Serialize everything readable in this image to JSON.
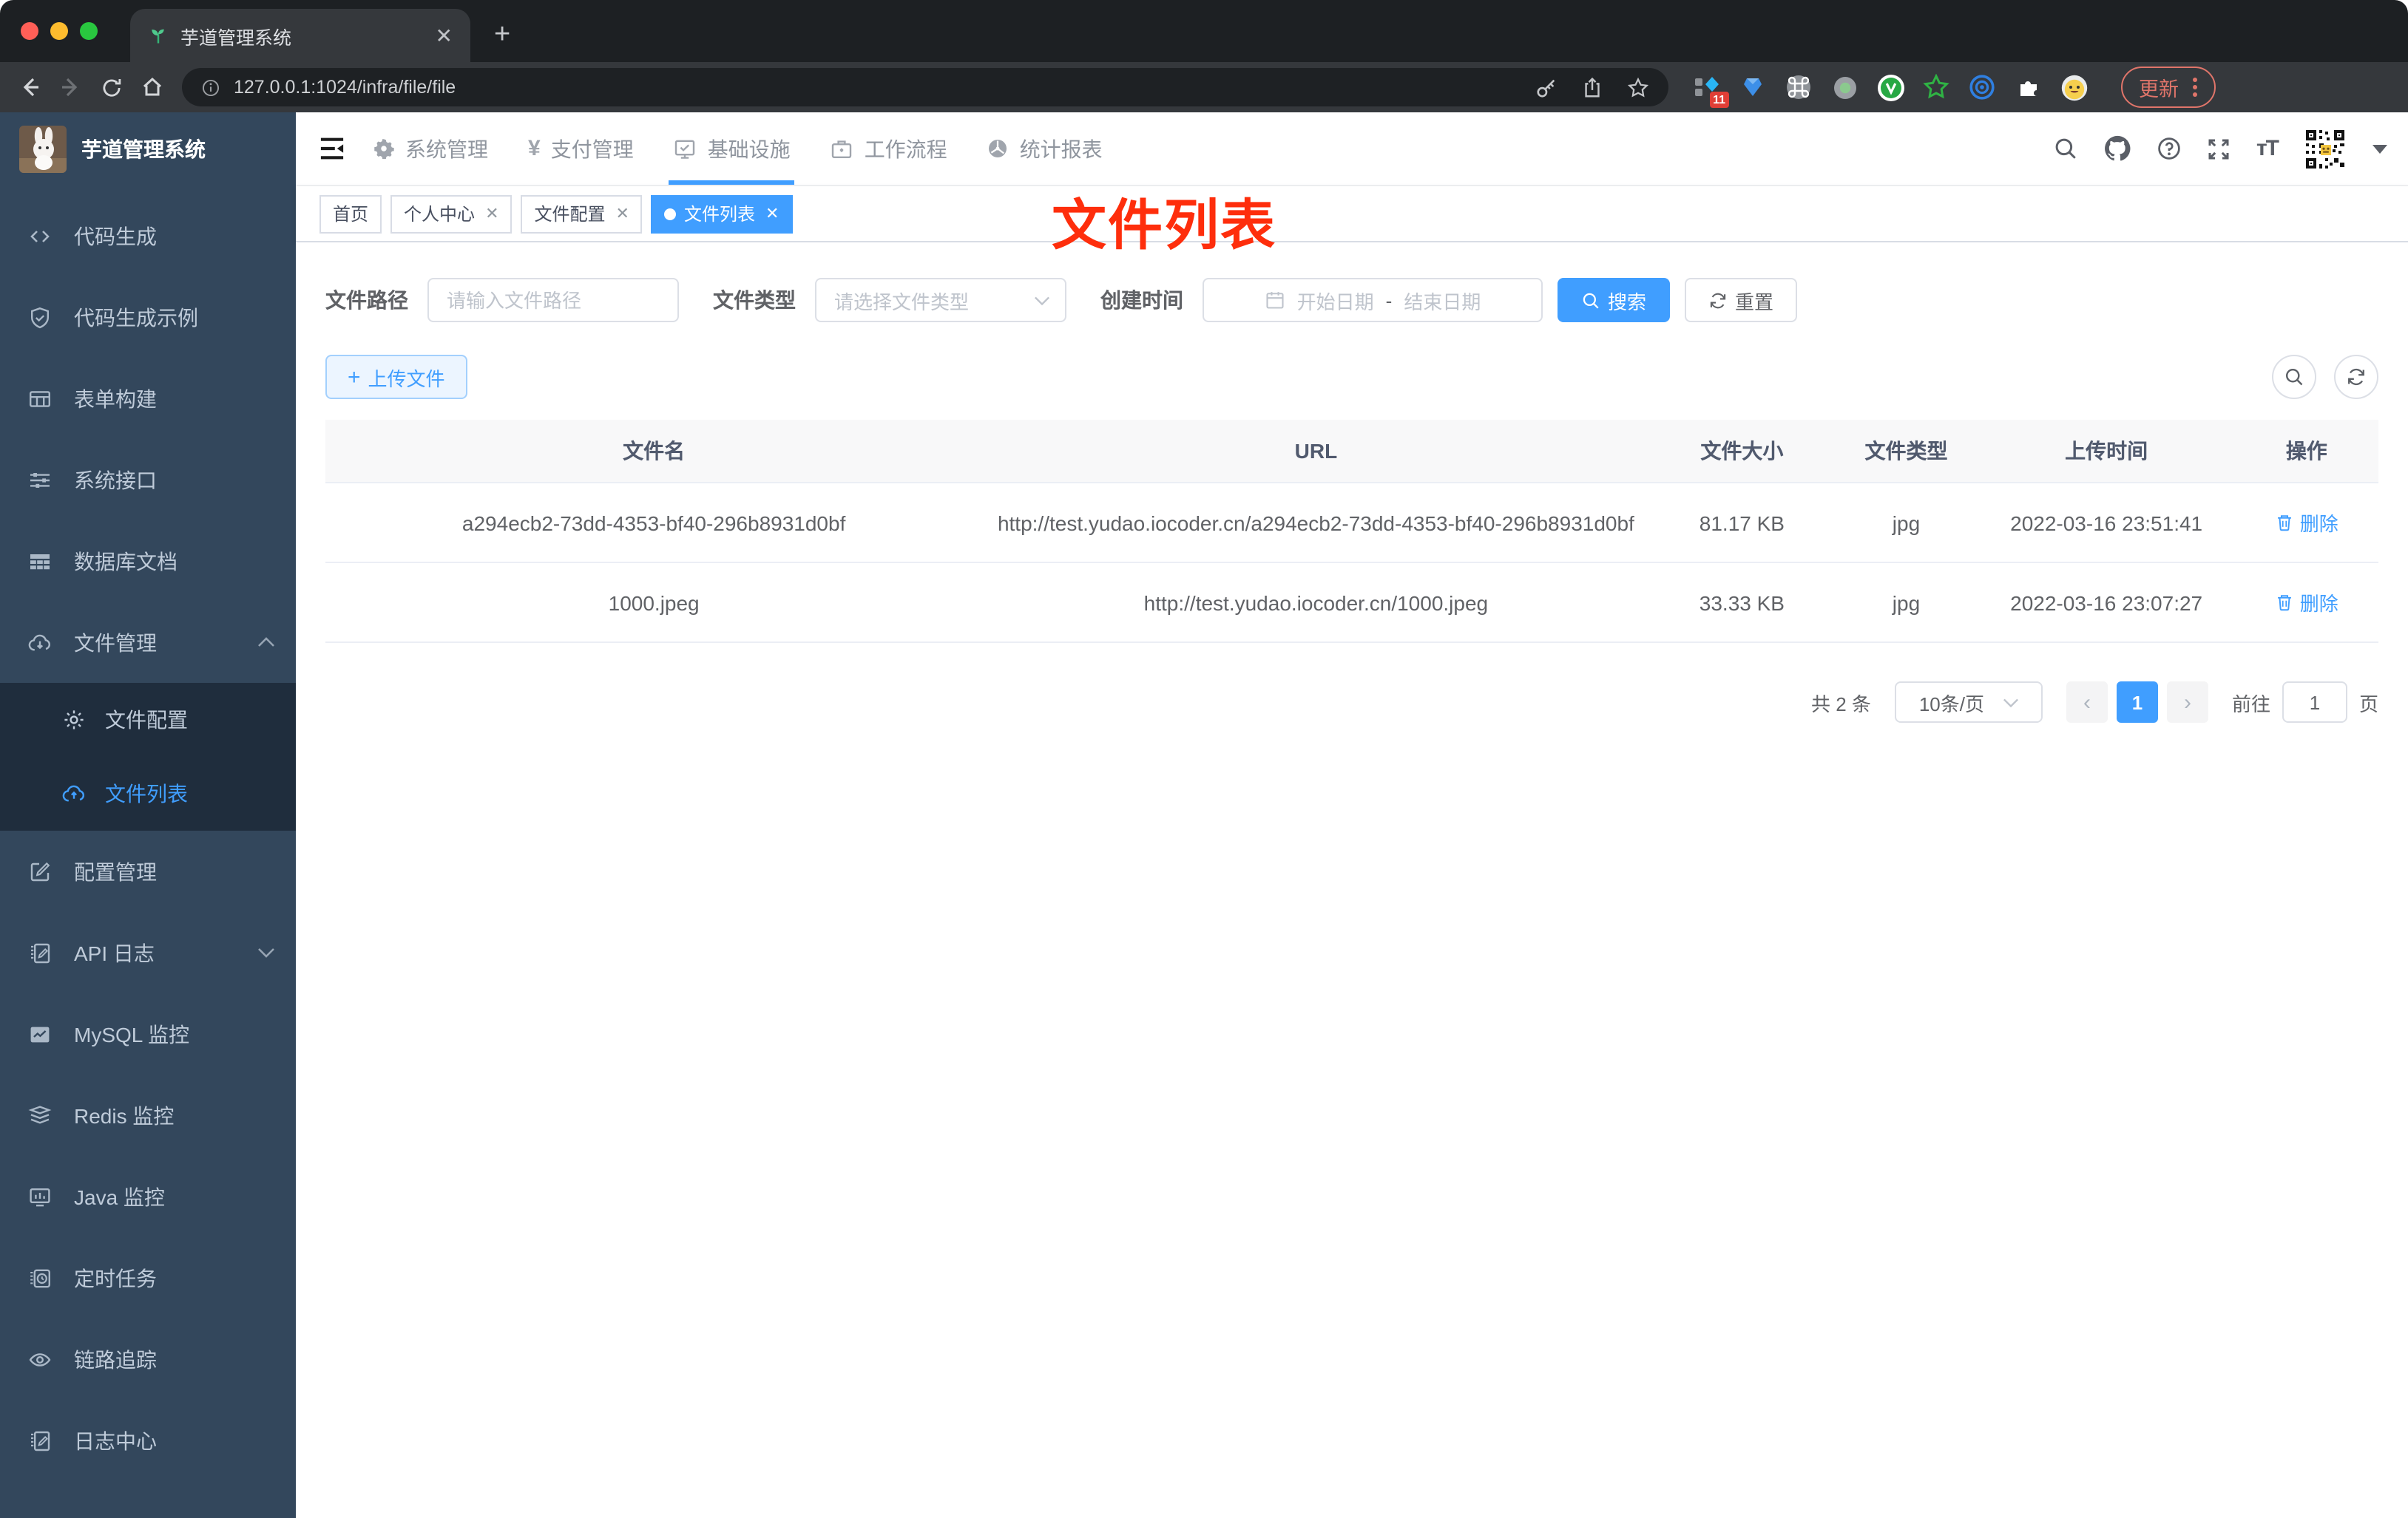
{
  "colors": {
    "accent": "#409eff",
    "annotation_red": "#fe2e0c",
    "sidebar_bg": "#33475c",
    "submenu_bg": "#1f2d3d",
    "update_pill": "#e0756a"
  },
  "browser": {
    "tab_title": "芋道管理系统",
    "url": "127.0.0.1:1024/infra/file/file",
    "update_label": "更新",
    "extension_badge": "11",
    "toolbar_icons": [
      "back-icon",
      "forward-icon",
      "reload-icon",
      "home-icon",
      "info-icon",
      "key-icon",
      "share-icon",
      "star-icon"
    ],
    "extension_icons": [
      "pinned-extension-icon",
      "gem-extension-icon",
      "command-extension-icon",
      "record-extension-icon",
      "v-extension-icon",
      "star-extension-icon",
      "eye-extension-icon",
      "puzzle-extension-icon",
      "emoji-extension-icon"
    ]
  },
  "sidebar": {
    "title": "芋道管理系统",
    "menu_top": [
      {
        "label": "代码生成",
        "icon": "code-icon"
      },
      {
        "label": "代码生成示例",
        "icon": "shield-check-icon"
      },
      {
        "label": "表单构建",
        "icon": "form-icon"
      },
      {
        "label": "系统接口",
        "icon": "sliders-icon"
      },
      {
        "label": "数据库文档",
        "icon": "grid-icon"
      }
    ],
    "file_management": {
      "label": "文件管理",
      "icon": "cloud-download-icon",
      "expanded": true
    },
    "submenu": [
      {
        "label": "文件配置",
        "icon": "gear-icon",
        "active": false
      },
      {
        "label": "文件列表",
        "icon": "cloud-upload-icon",
        "active": true
      }
    ],
    "menu_bottom": [
      {
        "label": "配置管理",
        "icon": "edit-square-icon"
      },
      {
        "label": "API 日志",
        "icon": "log-edit-icon",
        "expandable": true
      },
      {
        "label": "MySQL 监控",
        "icon": "chart-icon"
      },
      {
        "label": "Redis 监控",
        "icon": "layers-icon"
      },
      {
        "label": "Java 监控",
        "icon": "monitor-icon"
      },
      {
        "label": "定时任务",
        "icon": "timer-icon"
      },
      {
        "label": "链路追踪",
        "icon": "eye-icon"
      },
      {
        "label": "日志中心",
        "icon": "log-edit-icon"
      }
    ]
  },
  "topnav": {
    "items": [
      {
        "label": "系统管理",
        "icon": "gear-filled-icon",
        "active": false
      },
      {
        "label": "支付管理",
        "icon": "yen-icon",
        "active": false
      },
      {
        "label": "基础设施",
        "icon": "infra-monitor-icon",
        "active": true
      },
      {
        "label": "工作流程",
        "icon": "briefcase-icon",
        "active": false
      },
      {
        "label": "统计报表",
        "icon": "dashboard-icon",
        "active": false
      }
    ],
    "right_icons": [
      "search-icon",
      "github-icon",
      "help-icon",
      "fullscreen-icon",
      "font-size-icon",
      "qr-avatar",
      "caret-down-icon"
    ]
  },
  "tags": [
    {
      "label": "首页",
      "closable": false,
      "active": false
    },
    {
      "label": "个人中心",
      "closable": true,
      "active": false
    },
    {
      "label": "文件配置",
      "closable": true,
      "active": false
    },
    {
      "label": "文件列表",
      "closable": true,
      "active": true
    }
  ],
  "annotation": {
    "text": "文件列表"
  },
  "filters": {
    "path_label": "文件路径",
    "path_placeholder": "请输入文件路径",
    "type_label": "文件类型",
    "type_placeholder": "请选择文件类型",
    "time_label": "创建时间",
    "start_placeholder": "开始日期",
    "separator": "-",
    "end_placeholder": "结束日期",
    "search_label": "搜索",
    "reset_label": "重置"
  },
  "toolbar": {
    "upload_label": "上传文件",
    "right_icons": [
      "search-circle-icon",
      "refresh-circle-icon"
    ]
  },
  "table": {
    "headers": [
      "文件名",
      "URL",
      "文件大小",
      "文件类型",
      "上传时间",
      "操作"
    ],
    "rows": [
      {
        "name": "a294ecb2-73dd-4353-bf40-296b8931d0bf",
        "url": "http://test.yudao.iocoder.cn/a294ecb2-73dd-4353-bf40-296b8931d0bf",
        "size": "81.17 KB",
        "type": "jpg",
        "time": "2022-03-16 23:51:41",
        "action": "删除"
      },
      {
        "name": "1000.jpeg",
        "url": "http://test.yudao.iocoder.cn/1000.jpeg",
        "size": "33.33 KB",
        "type": "jpg",
        "time": "2022-03-16 23:07:27",
        "action": "删除"
      }
    ]
  },
  "pagination": {
    "total": "共 2 条",
    "page_size": "10条/页",
    "current_page": "1",
    "goto_label": "前往",
    "goto_value": "1",
    "page_unit": "页"
  }
}
